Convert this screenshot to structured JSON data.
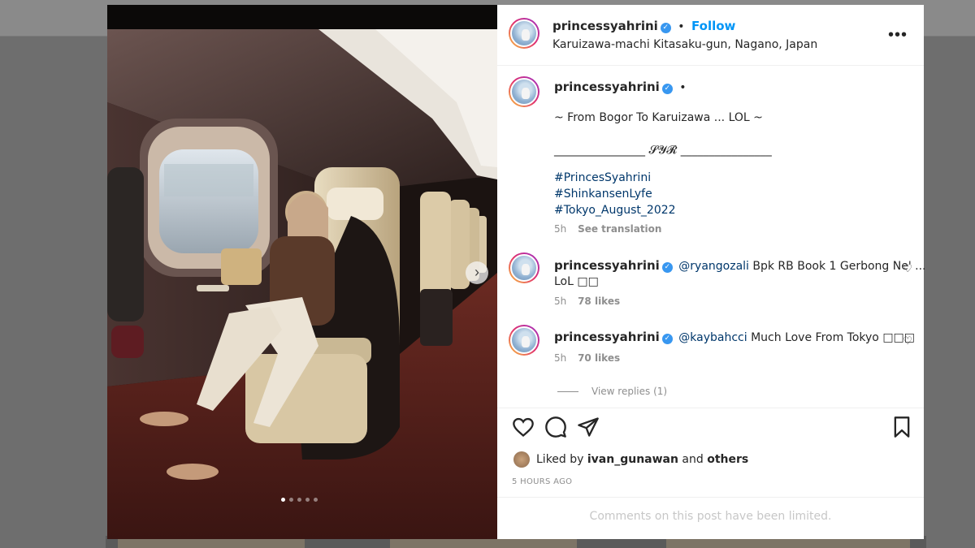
{
  "post": {
    "username": "princessyahrini",
    "follow_label": "Follow",
    "location": "Karuizawa-machi Kitasaku-gun, Nagano, Japan",
    "more_label": "•••",
    "caption": {
      "username": "princessyahrini",
      "line1": "~ From Bogor To Karuizawa ... LOL ~",
      "line2": "________________ 𝓢𝓨𝓡 ________________",
      "hashtags": [
        "#PrincesSyahrini",
        "#ShinkansenLyfe",
        "#Tokyo_August_2022"
      ],
      "time": "5h",
      "see_translation": "See translation"
    },
    "comments": [
      {
        "username": "princessyahrini",
        "mention": "@ryangozali",
        "text": " Bpk RB Book 1 Gerbong Ne' ...",
        "text2": "LoL □□",
        "time": "5h",
        "likes": "78 likes"
      },
      {
        "username": "princessyahrini",
        "mention": "@kaybahcci",
        "text": " Much Love From Tokyo □□□",
        "time": "5h",
        "likes": "70 likes"
      }
    ],
    "view_replies": "View replies (1)",
    "liked_by": {
      "prefix": "Liked by",
      "user": "ivan_gunawan",
      "and": "and",
      "others": "others"
    },
    "timestamp": "5 HOURS AGO",
    "comments_limited": "Comments on this post have been limited.",
    "carousel": {
      "total": 5,
      "active_index": 0,
      "next_icon": "›"
    },
    "separator_dot": "•",
    "verified_glyph": "✓",
    "heart_glyph": "♡"
  },
  "colors": {
    "link": "#0095f6",
    "verified": "#3897f0",
    "text": "#262626",
    "muted": "#8e8e8e"
  }
}
